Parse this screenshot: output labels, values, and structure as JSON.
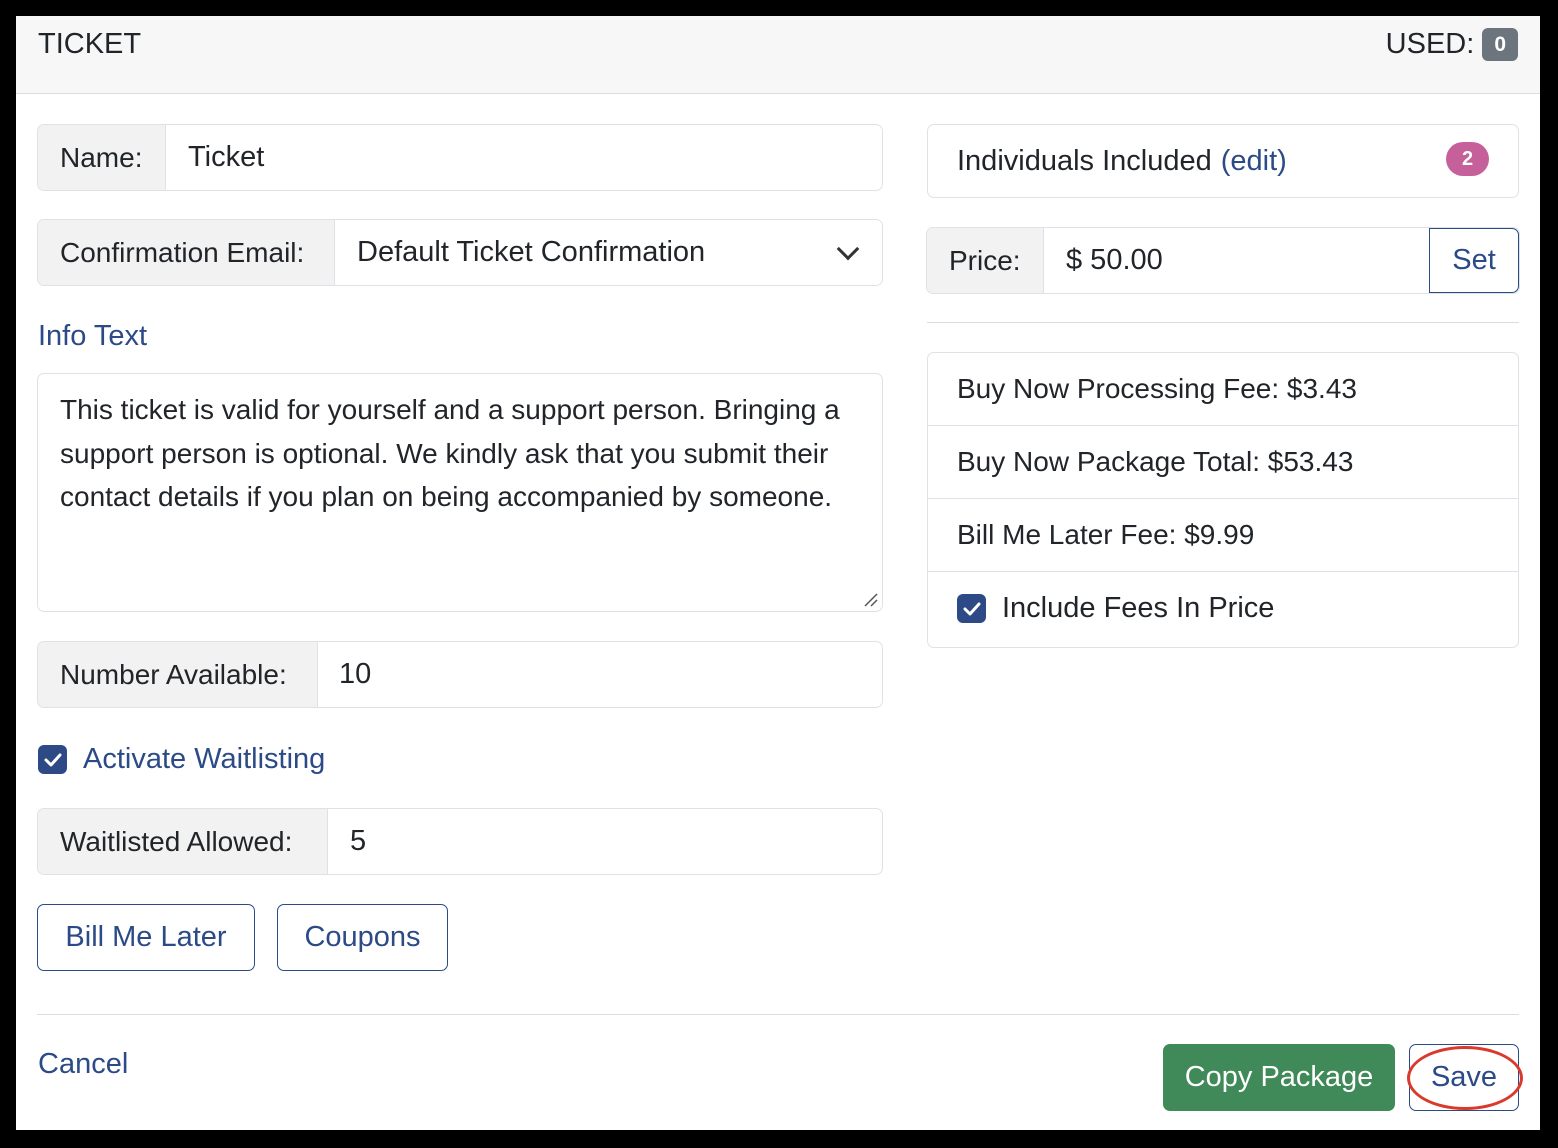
{
  "header": {
    "title": "TICKET",
    "used_label": "USED:",
    "used_count": "0"
  },
  "form": {
    "name_label": "Name:",
    "name_value": "Ticket",
    "confirmation_label": "Confirmation Email:",
    "confirmation_value": "Default Ticket Confirmation",
    "info_text_label": "Info Text",
    "info_text_value": "This ticket is valid for yourself and a support person. Bringing a support person is optional. We kindly ask that you submit their contact details if you plan on being accompanied by someone.",
    "number_available_label": "Number Available:",
    "number_available_value": "10",
    "waitlist_label": "Activate Waitlisting",
    "waitlist_checked": true,
    "waitlisted_allowed_label": "Waitlisted Allowed:",
    "waitlisted_allowed_value": "5",
    "bill_me_later_button": "Bill Me Later",
    "coupons_button": "Coupons"
  },
  "side": {
    "individuals_label": "Individuals Included",
    "individuals_edit": "(edit)",
    "individuals_count": "2",
    "price_label": "Price:",
    "price_value": "$ 50.00",
    "set_button": "Set",
    "fees": [
      "Buy Now Processing Fee: $3.43",
      "Buy Now Package Total: $53.43",
      "Bill Me Later Fee: $9.99"
    ],
    "include_fees_label": "Include Fees In Price",
    "include_fees_checked": true
  },
  "footer": {
    "cancel": "Cancel",
    "copy_package": "Copy Package",
    "save": "Save"
  },
  "colors": {
    "primary": "#2b4a86",
    "success": "#3f8a58",
    "badge_pink": "#c6609a",
    "badge_gray": "#6c757d",
    "highlight_ring": "#d93a2b"
  }
}
